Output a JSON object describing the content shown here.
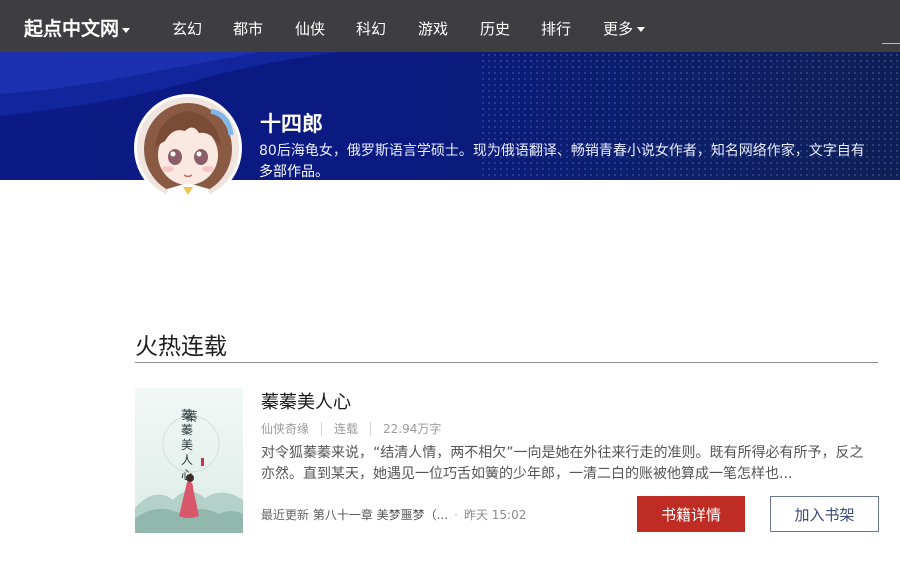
{
  "nav": {
    "brand": "起点中文网",
    "items": [
      "玄幻",
      "都市",
      "仙侠",
      "科幻",
      "游戏",
      "历史",
      "排行"
    ],
    "more": "更多"
  },
  "author": {
    "name": "十四郎",
    "bio_line1": "80后海龟女，俄罗斯语言学硕士。现为俄语翻译、畅销青春小说女作者，知名网络作家，文字自有",
    "bio_line2": "多部作品。"
  },
  "section": {
    "title": "火热连载"
  },
  "book": {
    "title": "蓁蓁美人心",
    "genre": "仙侠奇缘",
    "status": "连载",
    "words": "22.94万字",
    "description": "对令狐蓁蓁来说，“结清人情，两不相欠”一向是她在外往来行走的准则。既有所得必有所予，反之亦然。直到某天，她遇见一位巧舌如簧的少年郎，一清二白的账被他算成一笔怎样也...",
    "latest_prefix": "最近更新",
    "latest_chapter": "第八十一章 美梦噩梦（...",
    "latest_time": "昨天 15:02",
    "cover_title": "蓁蓁美人心",
    "detail_button": "书籍详情",
    "shelf_button": "加入书架"
  },
  "colors": {
    "nav_bg": "#3e3e41",
    "banner_bg": "#0c1a86",
    "accent_red": "#bf2c24"
  }
}
